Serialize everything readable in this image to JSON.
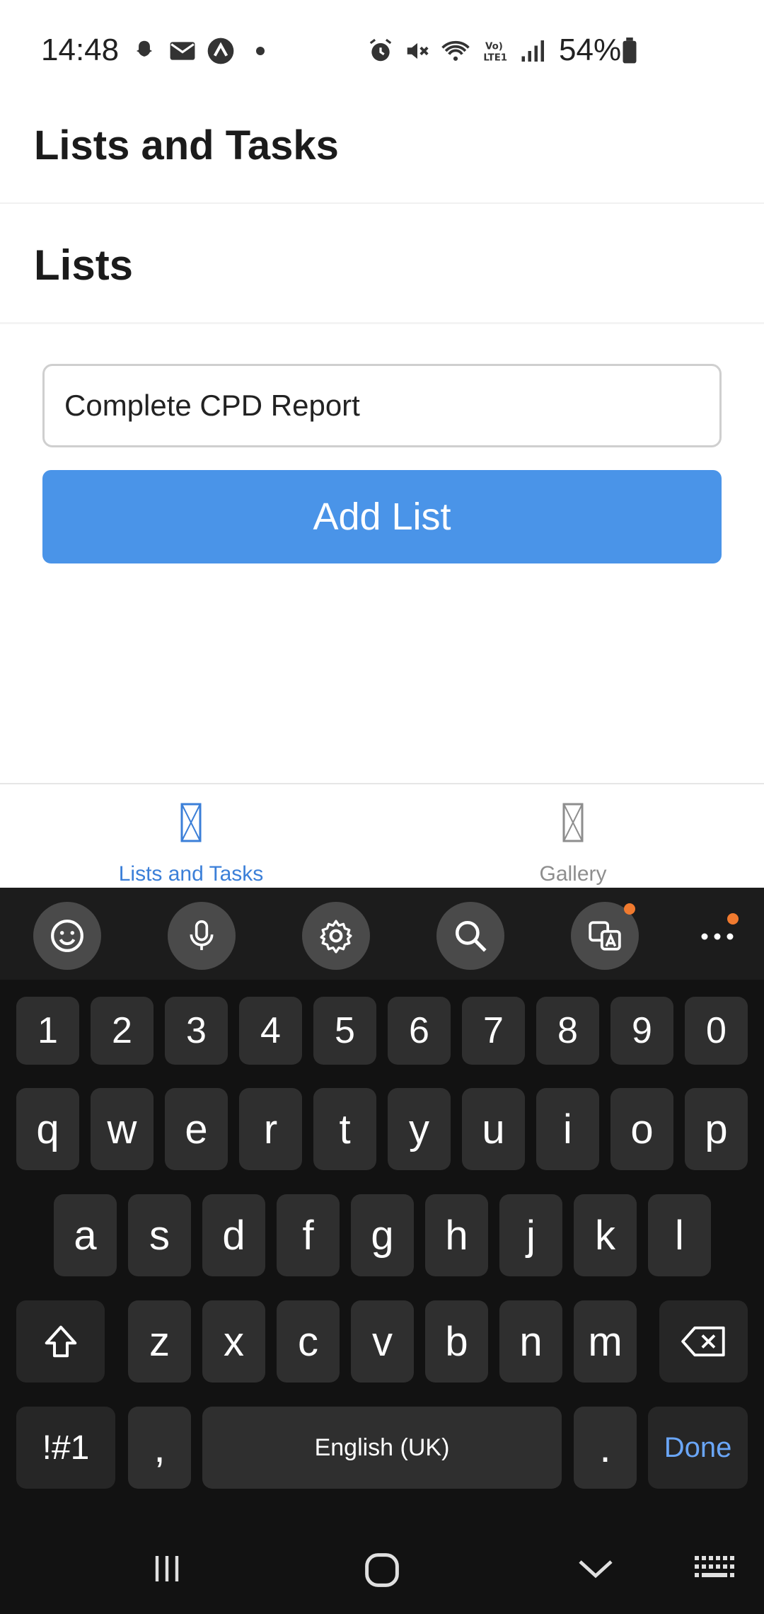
{
  "status_bar": {
    "time": "14:48",
    "battery": "54%",
    "icons": [
      "snapchat-icon",
      "mail-icon",
      "app-icon",
      "dot-icon",
      "alarm-icon",
      "mute-icon",
      "wifi-icon",
      "volte-icon",
      "signal-icon",
      "battery-icon"
    ]
  },
  "header": {
    "title": "Lists and Tasks"
  },
  "section": {
    "title": "Lists"
  },
  "form": {
    "input_value": "Complete CPD Report",
    "button_label": "Add List"
  },
  "tabs": [
    {
      "label": "Lists and Tasks",
      "active": true,
      "color": "#3b7fd8"
    },
    {
      "label": "Gallery",
      "active": false,
      "color": "#8e8e8e"
    }
  ],
  "keyboard": {
    "toolbar": [
      "emoji-icon",
      "microphone-icon",
      "settings-icon",
      "search-icon",
      "translate-icon",
      "more-icon"
    ],
    "number_row": [
      "1",
      "2",
      "3",
      "4",
      "5",
      "6",
      "7",
      "8",
      "9",
      "0"
    ],
    "row1": [
      "q",
      "w",
      "e",
      "r",
      "t",
      "y",
      "u",
      "i",
      "o",
      "p"
    ],
    "row2": [
      "a",
      "s",
      "d",
      "f",
      "g",
      "h",
      "j",
      "k",
      "l"
    ],
    "row3": [
      "z",
      "x",
      "c",
      "v",
      "b",
      "n",
      "m"
    ],
    "symbols_key": "!#1",
    "comma_key": ",",
    "space_label": "English (UK)",
    "period_key": ".",
    "done_label": "Done",
    "done_color": "#6aa6f8"
  },
  "nav_bar": {
    "icons": [
      "recents-icon",
      "home-icon",
      "back-icon",
      "keyboard-icon"
    ]
  }
}
